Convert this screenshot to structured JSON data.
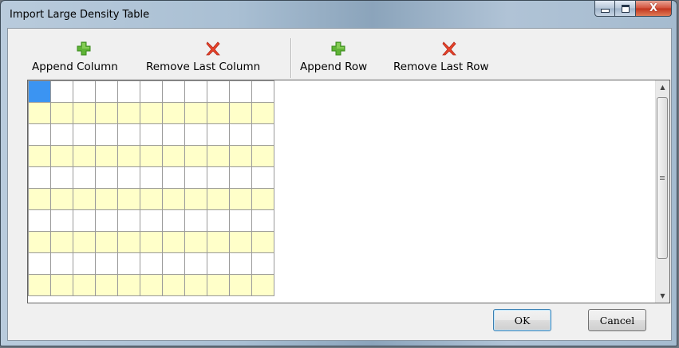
{
  "window": {
    "title": "Import Large Density Table",
    "caption_buttons": {
      "minimize_icon": "minimize-icon",
      "maximize_icon": "maximize-icon",
      "close_icon": "close-icon",
      "close_glyph": "X"
    }
  },
  "toolbar": {
    "append_column": {
      "label": "Append Column",
      "icon": "plus-icon"
    },
    "remove_last_column": {
      "label": "Remove Last Column",
      "icon": "x-icon"
    },
    "append_row": {
      "label": "Append Row",
      "icon": "plus-icon"
    },
    "remove_last_row": {
      "label": "Remove Last Row",
      "icon": "x-icon"
    }
  },
  "grid": {
    "rows": 10,
    "columns": 11,
    "selected_cell": {
      "row": 0,
      "column": 0
    },
    "row_colors": [
      "#ffffff",
      "#ffffc9"
    ],
    "selection_color": "#3b94f2"
  },
  "scrollbar": {
    "up_arrow": "▲",
    "down_arrow": "▼"
  },
  "buttons": {
    "ok": "OK",
    "cancel": "Cancel"
  },
  "colors": {
    "plus_icon": "#5fb336",
    "x_icon": "#e8442a"
  }
}
